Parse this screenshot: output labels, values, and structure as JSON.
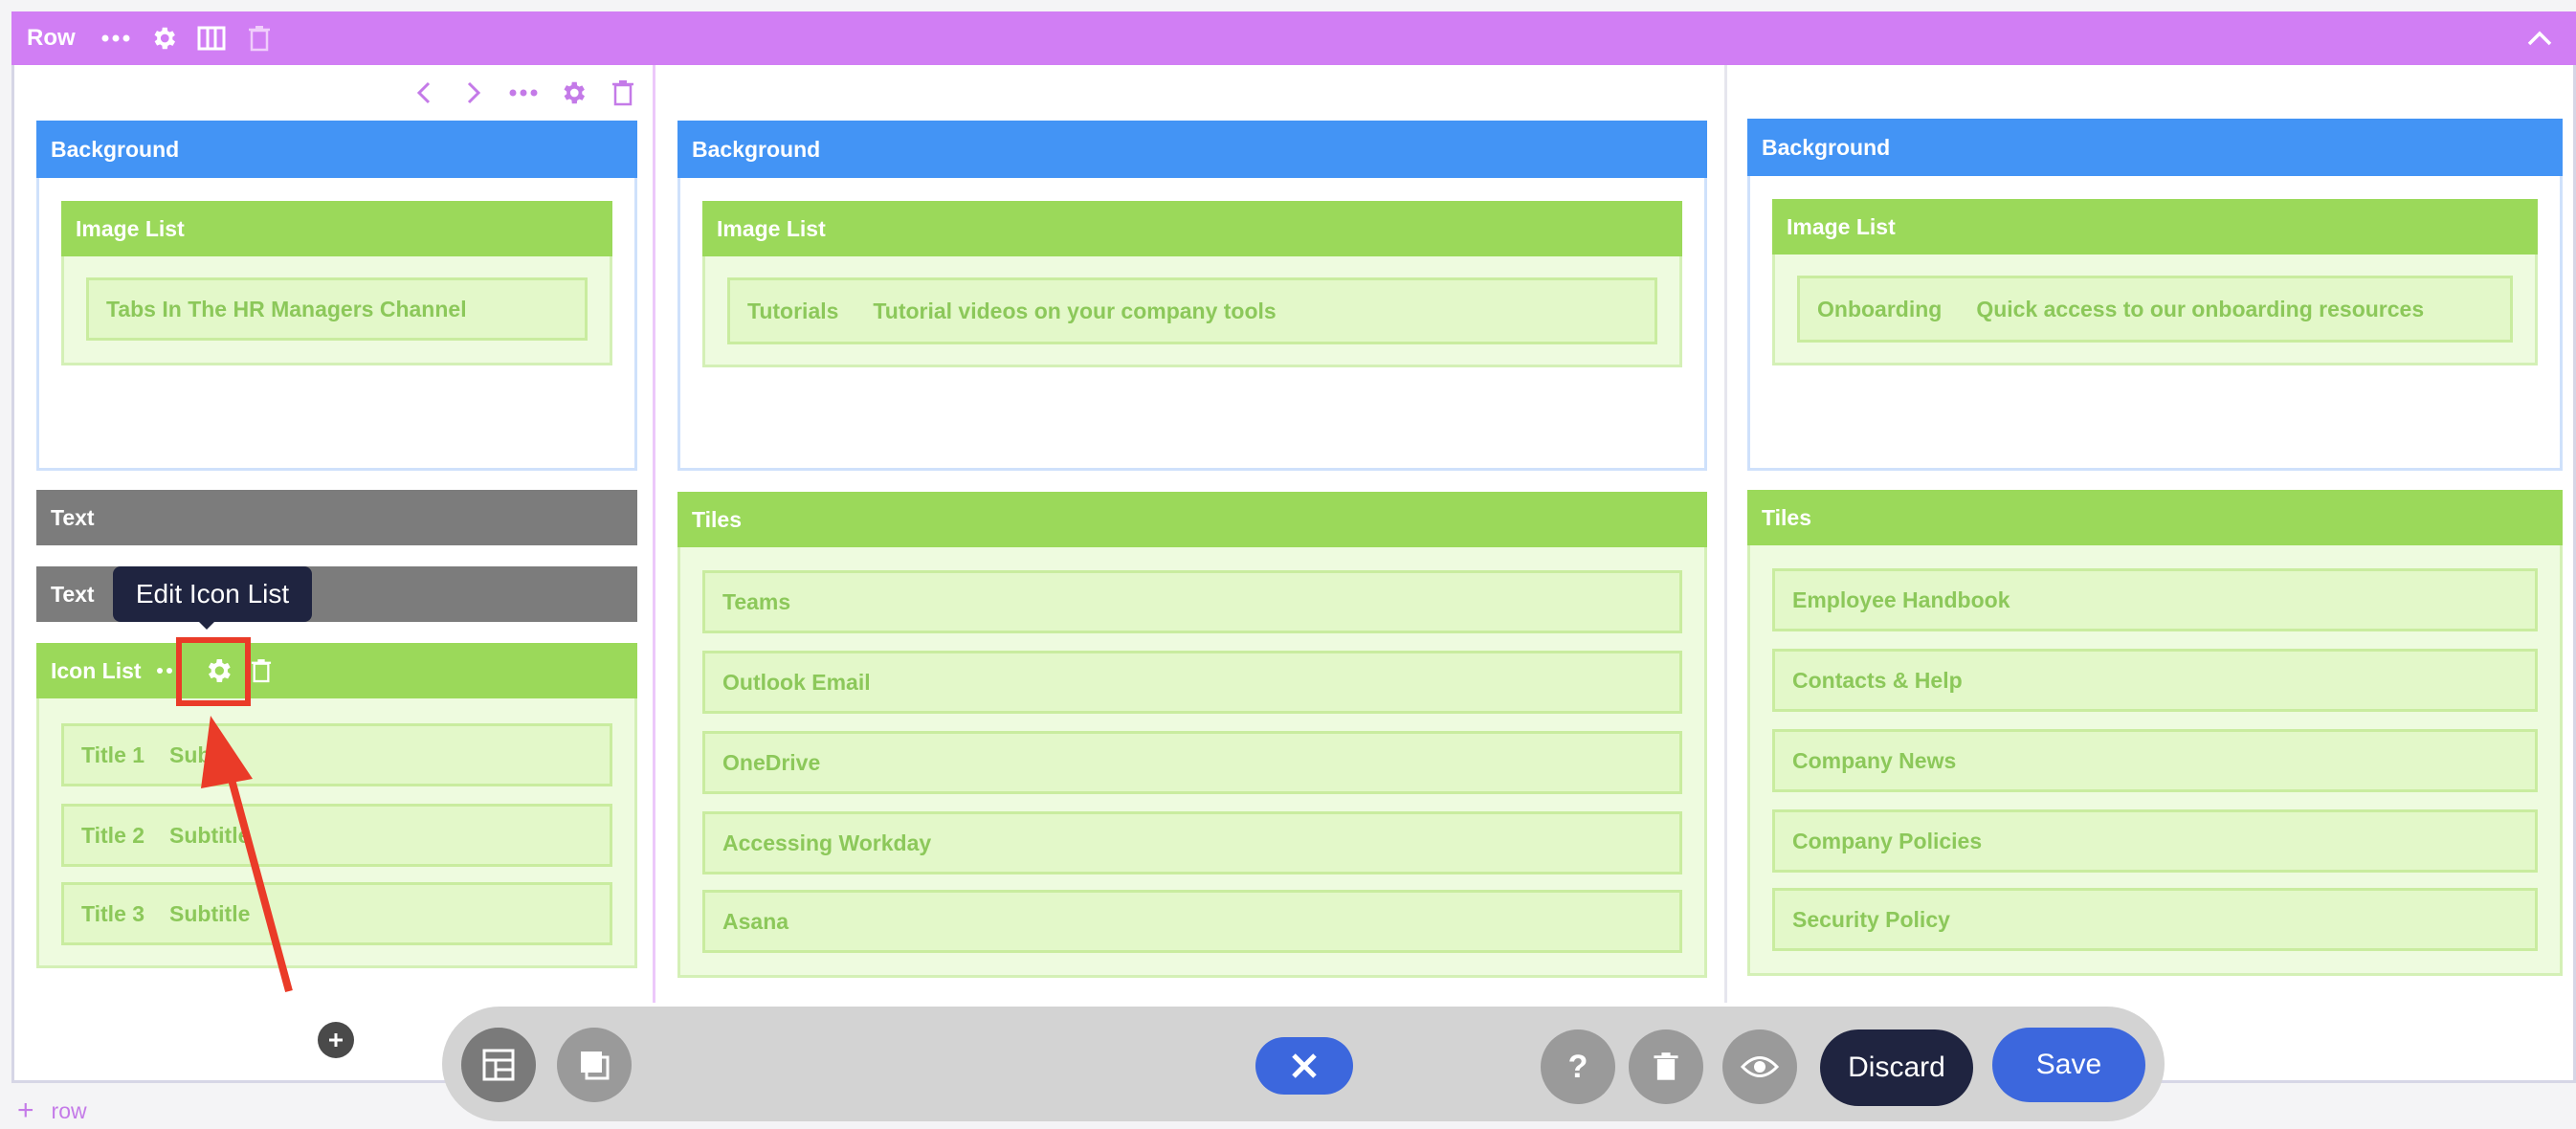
{
  "row_bar": {
    "label": "Row",
    "color": "#d17ef4"
  },
  "columns": [
    {
      "background": {
        "title": "Background",
        "image_list": {
          "title": "Image List",
          "items": [
            {
              "title": "Tabs In The HR Managers Channel",
              "subtitle": ""
            }
          ]
        }
      },
      "text_modules": [
        "Text",
        "Text"
      ],
      "icon_list": {
        "title": "Icon List",
        "items": [
          {
            "title": "Title 1",
            "subtitle": "Sub"
          },
          {
            "title": "Title 2",
            "subtitle": "Subtitle"
          },
          {
            "title": "Title 3",
            "subtitle": "Subtitle"
          }
        ]
      }
    },
    {
      "background": {
        "title": "Background",
        "image_list": {
          "title": "Image List",
          "items": [
            {
              "title": "Tutorials",
              "subtitle": "Tutorial videos on your company tools"
            }
          ]
        }
      },
      "tiles": {
        "title": "Tiles",
        "items": [
          "Teams",
          "Outlook Email",
          "OneDrive",
          "Accessing Workday",
          "Asana"
        ]
      }
    },
    {
      "background": {
        "title": "Background",
        "image_list": {
          "title": "Image List",
          "items": [
            {
              "title": "Onboarding",
              "subtitle": "Quick access to our onboarding resources"
            }
          ]
        }
      },
      "tiles": {
        "title": "Tiles",
        "items": [
          "Employee Handbook",
          "Contacts & Help",
          "Company News",
          "Company Policies",
          "Security Policy"
        ]
      }
    }
  ],
  "tooltip": "Edit Icon List",
  "toolbar": {
    "discard_label": "Discard",
    "save_label": "Save"
  },
  "add_row_label": "row",
  "colors": {
    "background_blue": "#4394f5",
    "module_green": "#9bd95a",
    "text_gray": "#7c7c7c",
    "highlight_red": "#ea3b28",
    "primary_button": "#3c67dd",
    "dark_button": "#1f2440"
  },
  "icons": {
    "row_bar": [
      "dots-icon",
      "gear-icon",
      "columns-icon",
      "trash-icon",
      "chevron-up-icon"
    ],
    "column_tools": [
      "chevron-left-icon",
      "chevron-right-icon",
      "dots-icon",
      "gear-icon",
      "trash-icon"
    ],
    "toolbar": [
      "layout-icon",
      "copy-icon",
      "close-icon",
      "help-icon",
      "trash-icon",
      "eye-icon"
    ],
    "add_module": "plus-icon"
  }
}
